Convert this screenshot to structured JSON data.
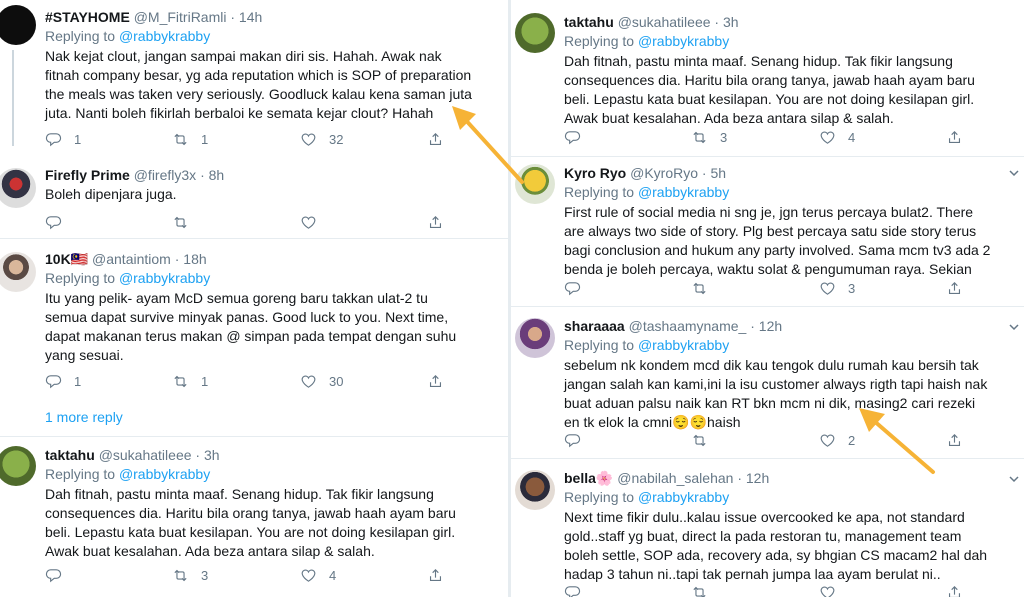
{
  "left": {
    "tweets": [
      {
        "name": "#STAYHOME",
        "handle": "@M_FitriRamli",
        "time": "14h",
        "replying_prefix": "Replying to ",
        "replying_to": "@rabbykrabby",
        "text": "Nak kejat clout, jangan sampai makan diri sis. Hahah. Awak nak\nfitnah company besar, yg ada reputation which is SOP of preparation\nthe meals was taken very seriously. Goodluck kalau kena saman juta\njuta. Nanti boleh fikirlah berbaloi ke semata kejar clout? Hahah",
        "replies": "1",
        "retweets": "1",
        "likes": "32"
      },
      {
        "name": "Firefly Prime",
        "handle": "@firefly3x",
        "time": "8h",
        "replying_prefix": "",
        "replying_to": "",
        "text": "Boleh dipenjara juga.",
        "replies": "",
        "retweets": "",
        "likes": ""
      },
      {
        "name": "10K🇲🇾",
        "handle": "@antaintiom",
        "time": "18h",
        "replying_prefix": "Replying to ",
        "replying_to": "@rabbykrabby",
        "text": "Itu yang pelik- ayam McD semua goreng baru takkan ulat-2 tu\nsemua dapat survive minyak panas. Good luck to you. Next time,\ndapat makanan terus makan @ simpan pada tempat dengan suhu\nyang sesuai.",
        "replies": "1",
        "retweets": "1",
        "likes": "30"
      },
      {
        "name": "taktahu",
        "handle": "@sukahatileee",
        "time": "3h",
        "replying_prefix": "Replying to ",
        "replying_to": "@rabbykrabby",
        "text": "Dah fitnah, pastu minta maaf. Senang hidup. Tak fikir langsung\nconsequences dia. Haritu bila orang tanya, jawab haah ayam baru\nbeli. Lepastu kata buat kesilapan. You are not doing kesilapan girl.\nAwak buat kesalahan. Ada beza antara silap & salah.",
        "replies": "",
        "retweets": "3",
        "likes": "4"
      }
    ],
    "more_reply": "1 more reply"
  },
  "right": {
    "tweets": [
      {
        "name": "taktahu",
        "handle": "@sukahatileee",
        "time": "3h",
        "replying_prefix": "Replying to ",
        "replying_to": "@rabbykrabby",
        "text": "Dah fitnah, pastu minta maaf. Senang hidup. Tak fikir langsung\nconsequences dia. Haritu bila orang tanya, jawab haah ayam baru\nbeli. Lepastu kata buat kesilapan. You are not doing kesilapan girl.\nAwak buat kesalahan. Ada beza antara silap & salah.",
        "replies": "",
        "retweets": "3",
        "likes": "4"
      },
      {
        "name": "Kyro Ryo",
        "handle": "@KyroRyo",
        "time": "5h",
        "replying_prefix": "Replying to ",
        "replying_to": "@rabbykrabby",
        "text": "First rule of social media ni sng je, jgn terus percaya bulat2. There\nare always two side of story. Plg best percaya satu side story terus\nbagi conclusion and hukum any party involved. Sama mcm tv3 ada 2\nbenda je boleh percaya, waktu solat & pengumuman raya. Sekian",
        "replies": "",
        "retweets": "",
        "likes": "3"
      },
      {
        "name": "sharaaaa",
        "handle": "@tashaamyname_",
        "time": "12h",
        "replying_prefix": "Replying to ",
        "replying_to": "@rabbykrabby",
        "text": "sebelum nk kondem mcd dik kau tengok dulu rumah kau bersih tak\njangan salah kan kami,ini la isu customer always rigth tapi haish nak\nbuat aduan palsu naik kan RT bkn mcm ni dik, masing2 cari rezeki\nen tk elok la cmni😌😌haish",
        "replies": "",
        "retweets": "",
        "likes": "2"
      },
      {
        "name": "bella🌸",
        "handle": "@nabilah_salehan",
        "time": "12h",
        "replying_prefix": "Replying to ",
        "replying_to": "@rabbykrabby",
        "text": "Next time fikir dulu..kalau issue overcooked ke apa, not standard\ngold..staff yg buat, direct la pada restoran tu, management team\nboleh settle, SOP ada, recovery ada, sy bhgian CS macam2 hal dah\nhadap 3 tahun ni..tapi tak pernah jumpa laa ayam berulat ni..",
        "replies": "",
        "retweets": "",
        "likes": ""
      }
    ]
  },
  "icons": {
    "reply": "reply-icon",
    "retweet": "retweet-icon",
    "like": "heart-icon",
    "share": "share-icon",
    "more": "chevron-down-icon"
  },
  "colors": {
    "link": "#1da1f2",
    "muted": "#657786",
    "annotation_arrow": "#f6b336"
  }
}
